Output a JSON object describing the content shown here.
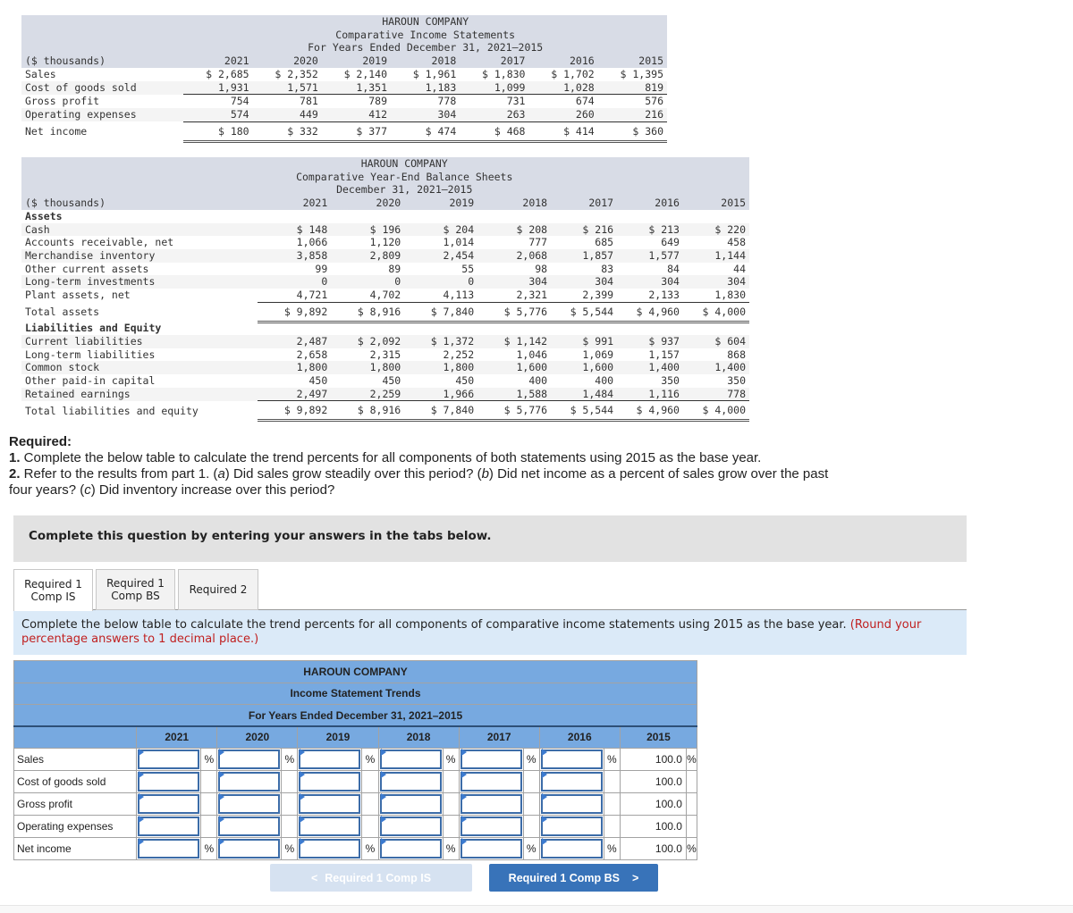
{
  "income_statement": {
    "company": "HAROUN COMPANY",
    "title": "Comparative Income Statements",
    "period": "For Years Ended December 31, 2021–2015",
    "unit_label": "($ thousands)",
    "years": [
      "2021",
      "2020",
      "2019",
      "2018",
      "2017",
      "2016",
      "2015"
    ],
    "rows": [
      {
        "label": "Sales",
        "values": [
          "$ 2,685",
          "$ 2,352",
          "$ 2,140",
          "$ 1,961",
          "$ 1,830",
          "$ 1,702",
          "$ 1,395"
        ]
      },
      {
        "label": "Cost of goods sold",
        "values": [
          "1,931",
          "1,571",
          "1,351",
          "1,183",
          "1,099",
          "1,028",
          "819"
        ]
      },
      {
        "label": "Gross profit",
        "values": [
          "754",
          "781",
          "789",
          "778",
          "731",
          "674",
          "576"
        ]
      },
      {
        "label": "Operating expenses",
        "values": [
          "574",
          "449",
          "412",
          "304",
          "263",
          "260",
          "216"
        ]
      },
      {
        "label": "Net income",
        "values": [
          "$ 180",
          "$ 332",
          "$ 377",
          "$ 474",
          "$ 468",
          "$ 414",
          "$ 360"
        ]
      }
    ]
  },
  "balance_sheet": {
    "company": "HAROUN COMPANY",
    "title": "Comparative Year-End Balance Sheets",
    "period": "December 31, 2021–2015",
    "unit_label": "($ thousands)",
    "years": [
      "2021",
      "2020",
      "2019",
      "2018",
      "2017",
      "2016",
      "2015"
    ],
    "assets_heading": "Assets",
    "assets": [
      {
        "label": "Cash",
        "values": [
          "$ 148",
          "$ 196",
          "$ 204",
          "$ 208",
          "$ 216",
          "$ 213",
          "$ 220"
        ]
      },
      {
        "label": "Accounts receivable, net",
        "values": [
          "1,066",
          "1,120",
          "1,014",
          "777",
          "685",
          "649",
          "458"
        ]
      },
      {
        "label": "Merchandise inventory",
        "values": [
          "3,858",
          "2,809",
          "2,454",
          "2,068",
          "1,857",
          "1,577",
          "1,144"
        ]
      },
      {
        "label": "Other current assets",
        "values": [
          "99",
          "89",
          "55",
          "98",
          "83",
          "84",
          "44"
        ]
      },
      {
        "label": "Long-term investments",
        "values": [
          "0",
          "0",
          "0",
          "304",
          "304",
          "304",
          "304"
        ]
      },
      {
        "label": "Plant assets, net",
        "values": [
          "4,721",
          "4,702",
          "4,113",
          "2,321",
          "2,399",
          "2,133",
          "1,830"
        ]
      }
    ],
    "total_assets": {
      "label": "Total assets",
      "values": [
        "$ 9,892",
        "$ 8,916",
        "$ 7,840",
        "$ 5,776",
        "$ 5,544",
        "$ 4,960",
        "$ 4,000"
      ]
    },
    "liab_heading": "Liabilities and Equity",
    "liabilities": [
      {
        "label": "Current liabilities",
        "values": [
          "2,487",
          "$ 2,092",
          "$ 1,372",
          "$ 1,142",
          "$ 991",
          "$ 937",
          "$ 604"
        ]
      },
      {
        "label": "Long-term liabilities",
        "values": [
          "2,658",
          "2,315",
          "2,252",
          "1,046",
          "1,069",
          "1,157",
          "868"
        ]
      },
      {
        "label": "Common stock",
        "values": [
          "1,800",
          "1,800",
          "1,800",
          "1,600",
          "1,600",
          "1,400",
          "1,400"
        ]
      },
      {
        "label": "Other paid-in capital",
        "values": [
          "450",
          "450",
          "450",
          "400",
          "400",
          "350",
          "350"
        ]
      },
      {
        "label": "Retained earnings",
        "values": [
          "2,497",
          "2,259",
          "1,966",
          "1,588",
          "1,484",
          "1,116",
          "778"
        ]
      }
    ],
    "total_liab": {
      "label": "Total liabilities and equity",
      "values": [
        "$ 9,892",
        "$ 8,916",
        "$ 7,840",
        "$ 5,776",
        "$ 5,544",
        "$ 4,960",
        "$ 4,000"
      ]
    }
  },
  "required": {
    "heading": "Required:",
    "item1_num": "1.",
    "item1_text": " Complete the below table to calculate the trend percents for all components of both statements using 2015 as the base year.",
    "item2_num": "2.",
    "item2_text_a": " Refer to the results from part 1. (",
    "item2_a": "a",
    "item2_text_b": ") Did sales grow steadily over this period? (",
    "item2_b": "b",
    "item2_text_c": ") Did net income as a percent of sales grow over the past four years? (",
    "item2_c": "c",
    "item2_text_d": ") Did inventory increase over this period?"
  },
  "banner": "Complete this question by entering your answers in the tabs below.",
  "tabs": [
    {
      "line1": "Required 1",
      "line2": "Comp IS",
      "active": true
    },
    {
      "line1": "Required 1",
      "line2": "Comp BS",
      "active": false
    },
    {
      "line1": "Required 2",
      "line2": "",
      "active": false
    }
  ],
  "task": {
    "text": "Complete the below table to calculate the trend percents for all components of comparative income statements using 2015 as the base year. ",
    "note": "(Round your percentage answers to 1 decimal place.)"
  },
  "trend_table": {
    "company": "HAROUN COMPANY",
    "title": "Income Statement Trends",
    "period": "For Years Ended December 31, 2021–2015",
    "years": [
      "2021",
      "2020",
      "2019",
      "2018",
      "2017",
      "2016",
      "2015"
    ],
    "percent_symbol": "%",
    "rows": [
      {
        "label": "Sales",
        "show_pct": true,
        "inputs": [
          "",
          "",
          "",
          "",
          "",
          ""
        ],
        "base": "100.0"
      },
      {
        "label": "Cost of goods sold",
        "show_pct": false,
        "inputs": [
          "",
          "",
          "",
          "",
          "",
          ""
        ],
        "base": "100.0"
      },
      {
        "label": "Gross profit",
        "show_pct": false,
        "inputs": [
          "",
          "",
          "",
          "",
          "",
          ""
        ],
        "base": "100.0"
      },
      {
        "label": "Operating expenses",
        "show_pct": false,
        "inputs": [
          "",
          "",
          "",
          "",
          "",
          ""
        ],
        "base": "100.0"
      },
      {
        "label": "Net income",
        "show_pct": true,
        "inputs": [
          "",
          "",
          "",
          "",
          "",
          ""
        ],
        "base": "100.0"
      }
    ]
  },
  "nav": {
    "prev_label": "Required 1 Comp IS",
    "prev_icon": "<",
    "next_label": "Required 1 Comp BS",
    "next_icon": ">"
  }
}
